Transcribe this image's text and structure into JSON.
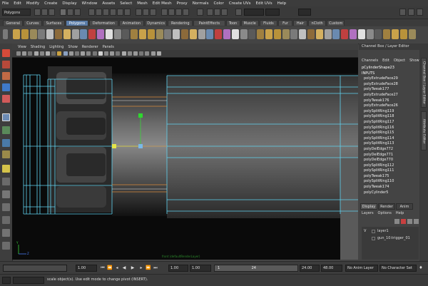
{
  "menubar": {
    "items": [
      "File",
      "Edit",
      "Modify",
      "Create",
      "Display",
      "Window",
      "Assets",
      "Select",
      "Mesh",
      "Edit Mesh",
      "Proxy",
      "Normals",
      "Color",
      "Create UVs",
      "Edit UVs",
      "Help"
    ]
  },
  "statusline": {
    "mode": "Polygons"
  },
  "shelf": {
    "tabs": [
      "General",
      "Curves",
      "Surfaces",
      "Polygons",
      "Deformation",
      "Animation",
      "Dynamics",
      "Rendering",
      "PaintEffects",
      "Toon",
      "Muscle",
      "Fluids",
      "Fur",
      "Hair",
      "nCloth",
      "Custom"
    ],
    "active_tab": "Polygons"
  },
  "panel": {
    "menu": [
      "View",
      "Shading",
      "Lighting",
      "Show",
      "Renderer",
      "Panels"
    ],
    "camera_label": "front (defaultRenderLayer)"
  },
  "channelbox": {
    "title": "Channel Box / Layer Editor",
    "menu": [
      "Channels",
      "Edit",
      "Object",
      "Show"
    ],
    "shape": "pCylinderShape23",
    "inputs_label": "INPUTS",
    "history": [
      "polyExtrudeFace29",
      "polyExtrudeFace28",
      "polyTweak177",
      "polyExtrudeFace27",
      "polyTweak176",
      "polyExtrudeFace26",
      "polySplitRing119",
      "polySplitRing118",
      "polySplitRing117",
      "polySplitRing116",
      "polySplitRing115",
      "polySplitRing114",
      "polySplitRing113",
      "polyDelEdge772",
      "polyDelEdge771",
      "polyDelEdge770",
      "polySplitRing112",
      "polySplitRing111",
      "polyTweak175",
      "polySplitRing110",
      "polyTweak174",
      "polyCylinder5"
    ],
    "side_tabs": [
      "Channel Box / Layer Editor",
      "Attribute Editor"
    ]
  },
  "layers": {
    "tabs": [
      "Display",
      "Render",
      "Anim"
    ],
    "active_tab": "Display",
    "menu": [
      "Layers",
      "Options",
      "Help"
    ],
    "rows": [
      {
        "v": "V",
        "name": "layer1"
      },
      {
        "v": "",
        "name": "gun_10:trigger_01"
      }
    ]
  },
  "timeslider": {
    "start": "1.00",
    "current": "1.00",
    "range_start": "1.00",
    "range_start_field": "1",
    "range_end_field": "24",
    "end": "24.00",
    "anim_end": "48.00",
    "anim_layer": "No Anim Layer",
    "char_set": "No Character Set"
  },
  "helpline": {
    "text": "scale object(s). Use edit mode to change pivot (INSERT)."
  },
  "colors": {
    "wire": "#5fd3f0",
    "accent": "#5a7ca8"
  }
}
